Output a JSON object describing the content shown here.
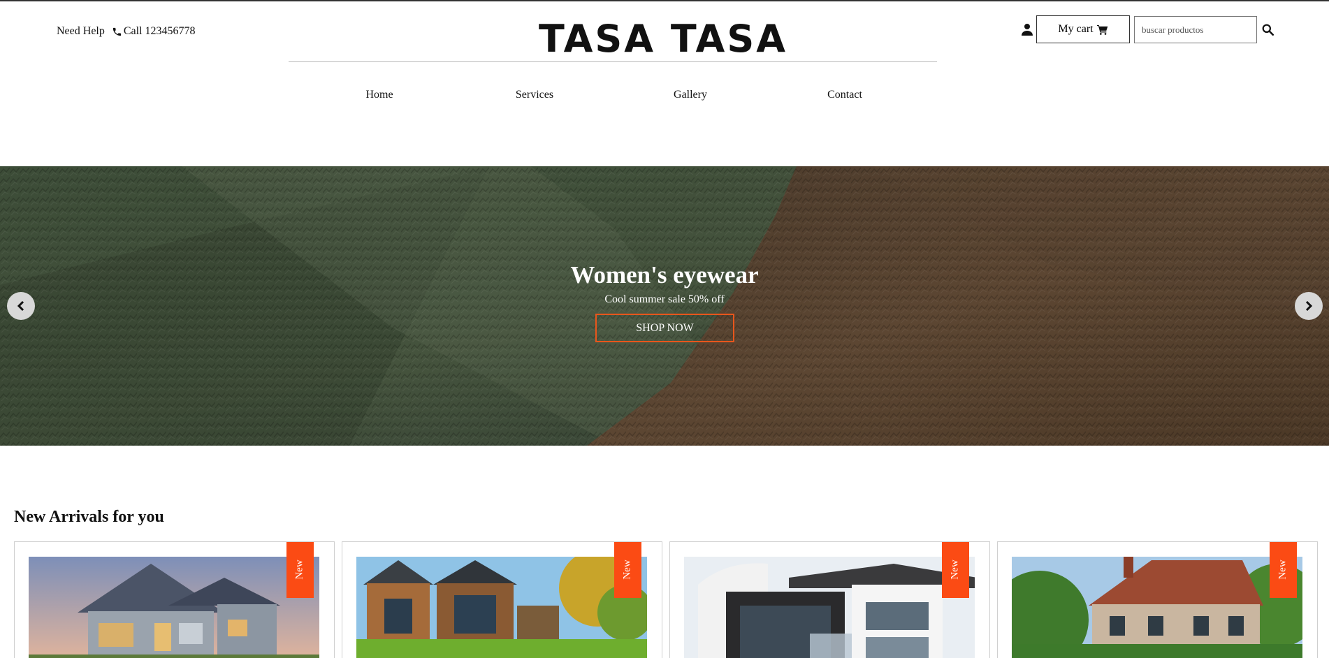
{
  "header": {
    "help_text": "Need Help",
    "phone_text": "Call 123456778",
    "logo": "TASA TASA",
    "cart_label": "My cart",
    "search_placeholder": "buscar productos"
  },
  "nav": {
    "items": [
      {
        "label": "Home"
      },
      {
        "label": "Services"
      },
      {
        "label": "Gallery"
      },
      {
        "label": "Contact"
      }
    ]
  },
  "hero": {
    "title": "Women's eyewear",
    "subtitle": "Cool summer sale 50% off",
    "button_label": "SHOP NOW"
  },
  "arrivals": {
    "title": "New Arrivals for you",
    "badge_label": "New",
    "cards": [
      {
        "image": "suburban-house-photo"
      },
      {
        "image": "modern-wooden-houses-photo"
      },
      {
        "image": "modern-white-villa-photo"
      },
      {
        "image": "brick-cottage-photo"
      }
    ]
  },
  "colors": {
    "accent": "#fb4b14",
    "text": "#111111",
    "hero_overlay": "#3f4a37"
  },
  "icons": [
    "phone-icon",
    "user-icon",
    "cart-icon",
    "search-icon",
    "chevron-left-icon",
    "chevron-right-icon"
  ]
}
